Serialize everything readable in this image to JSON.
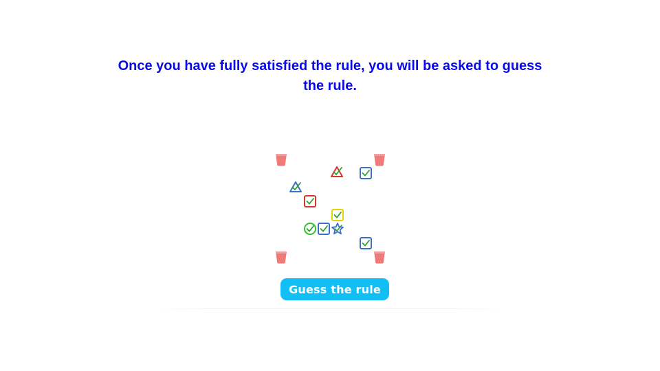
{
  "instruction": {
    "line1": "Once you have fully satisfied the rule, you will be asked to guess",
    "line2": "the rule."
  },
  "colors": {
    "instruction_text": "#0a0ae6",
    "button_bg": "#12bff5",
    "bucket": "#f07a7a",
    "red": "#d9342b",
    "blue": "#3b6fc9",
    "green": "#2fc12f",
    "yellow": "#e8d200"
  },
  "board": {
    "buckets": [
      {
        "name": "bucket-top-left",
        "icon": "bucket-icon"
      },
      {
        "name": "bucket-top-right",
        "icon": "bucket-icon"
      },
      {
        "name": "bucket-bottom-left",
        "icon": "bucket-icon"
      },
      {
        "name": "bucket-bottom-right",
        "icon": "bucket-icon"
      }
    ],
    "pieces": [
      {
        "shape": "triangle",
        "color": "red",
        "icon": "red-triangle-icon"
      },
      {
        "shape": "square",
        "color": "blue",
        "icon": "blue-square-icon"
      },
      {
        "shape": "triangle",
        "color": "blue",
        "icon": "blue-triangle-icon"
      },
      {
        "shape": "square",
        "color": "red",
        "icon": "red-square-icon"
      },
      {
        "shape": "square",
        "color": "yellow",
        "icon": "yellow-square-icon"
      },
      {
        "shape": "circle",
        "color": "green",
        "icon": "green-circle-icon"
      },
      {
        "shape": "square",
        "color": "blue",
        "icon": "blue-square-icon"
      },
      {
        "shape": "star",
        "color": "blue",
        "icon": "blue-star-icon"
      },
      {
        "shape": "square",
        "color": "blue",
        "icon": "blue-square-icon"
      }
    ]
  },
  "guess_button": {
    "label": "Guess the rule"
  }
}
